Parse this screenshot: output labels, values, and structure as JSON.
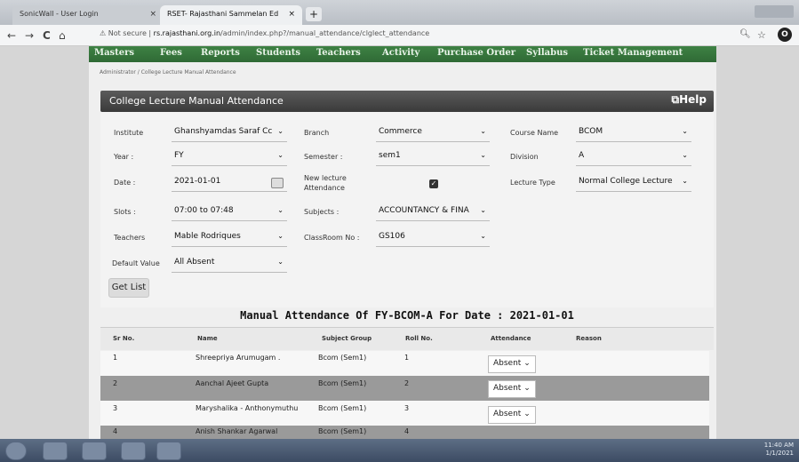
{
  "browser": {
    "tab1_title": "SonicWall - User Login",
    "tab2_title": "RSET- Rajasthani Sammelan Ed",
    "tab_close": "×",
    "new_tab": "+",
    "nav": {
      "back": "←",
      "forward": "→",
      "reload": "C",
      "home": "⌂"
    },
    "security_label": "Not secure",
    "url_domain": "rs.rajasthani.org.in",
    "url_path": "/admin/index.php?/manual_attendance/clglect_attendance",
    "profile_letter": "O"
  },
  "menu": [
    "Masters",
    "Fees",
    "Reports",
    "Students",
    "Teachers",
    "Activity",
    "Purchase Order",
    "Syllabus",
    "Ticket Management"
  ],
  "breadcrumb": "Administrator / College Lecture Manual Attendance",
  "panel": {
    "title": "College Lecture Manual Attendance",
    "help_label": "Help"
  },
  "form": {
    "institute_label": "Institute",
    "institute_value": "Ghanshyamdas Saraf Cc",
    "branch_label": "Branch",
    "branch_value": "Commerce",
    "course_label": "Course Name",
    "course_value": "BCOM",
    "year_label": "Year :",
    "year_value": "FY",
    "semester_label": "Semester :",
    "semester_value": "sem1",
    "division_label": "Division",
    "division_value": "A",
    "date_label": "Date :",
    "date_value": "2021-01-01",
    "new_lecture_label_1": "New lecture",
    "new_lecture_label_2": "Attendance",
    "lecture_type_label": "Lecture Type",
    "lecture_type_value": "Normal College Lecture",
    "slots_label": "Slots :",
    "slots_value": "07:00 to 07:48",
    "subjects_label": "Subjects :",
    "subjects_value": "ACCOUNTANCY & FINA",
    "teachers_label": "Teachers",
    "teachers_value": "Mable Rodriques",
    "classroom_label": "ClassRoom No :",
    "classroom_value": "GS106",
    "default_label": "Default Value",
    "default_value": "All Absent",
    "get_list": "Get List"
  },
  "table": {
    "title": "Manual Attendance Of FY-BCOM-A For Date : 2021-01-01",
    "headers": [
      "Sr No.",
      "Name",
      "Subject Group",
      "Roll No.",
      "Attendance",
      "Reason"
    ],
    "rows": [
      {
        "sr": "1",
        "name": "Shreepriya Arumugam .",
        "group": "Bcom (Sem1)",
        "roll": "1",
        "att": "Absent"
      },
      {
        "sr": "2",
        "name": "Aanchal Ajeet Gupta",
        "group": "Bcom (Sem1)",
        "roll": "2",
        "att": "Absent"
      },
      {
        "sr": "3",
        "name": "Maryshalika - Anthonymuthu",
        "group": "Bcom (Sem1)",
        "roll": "3",
        "att": "Absent"
      },
      {
        "sr": "4",
        "name": "Anish Shankar Agarwal",
        "group": "Bcom (Sem1)",
        "roll": "4",
        "att": ""
      }
    ]
  },
  "taskbar": {
    "time": "11:40 AM",
    "date": "1/1/2021"
  },
  "icons": {
    "chevron": "⌄",
    "calendar": "calendar-icon",
    "check": "✓",
    "help": "⧉"
  }
}
